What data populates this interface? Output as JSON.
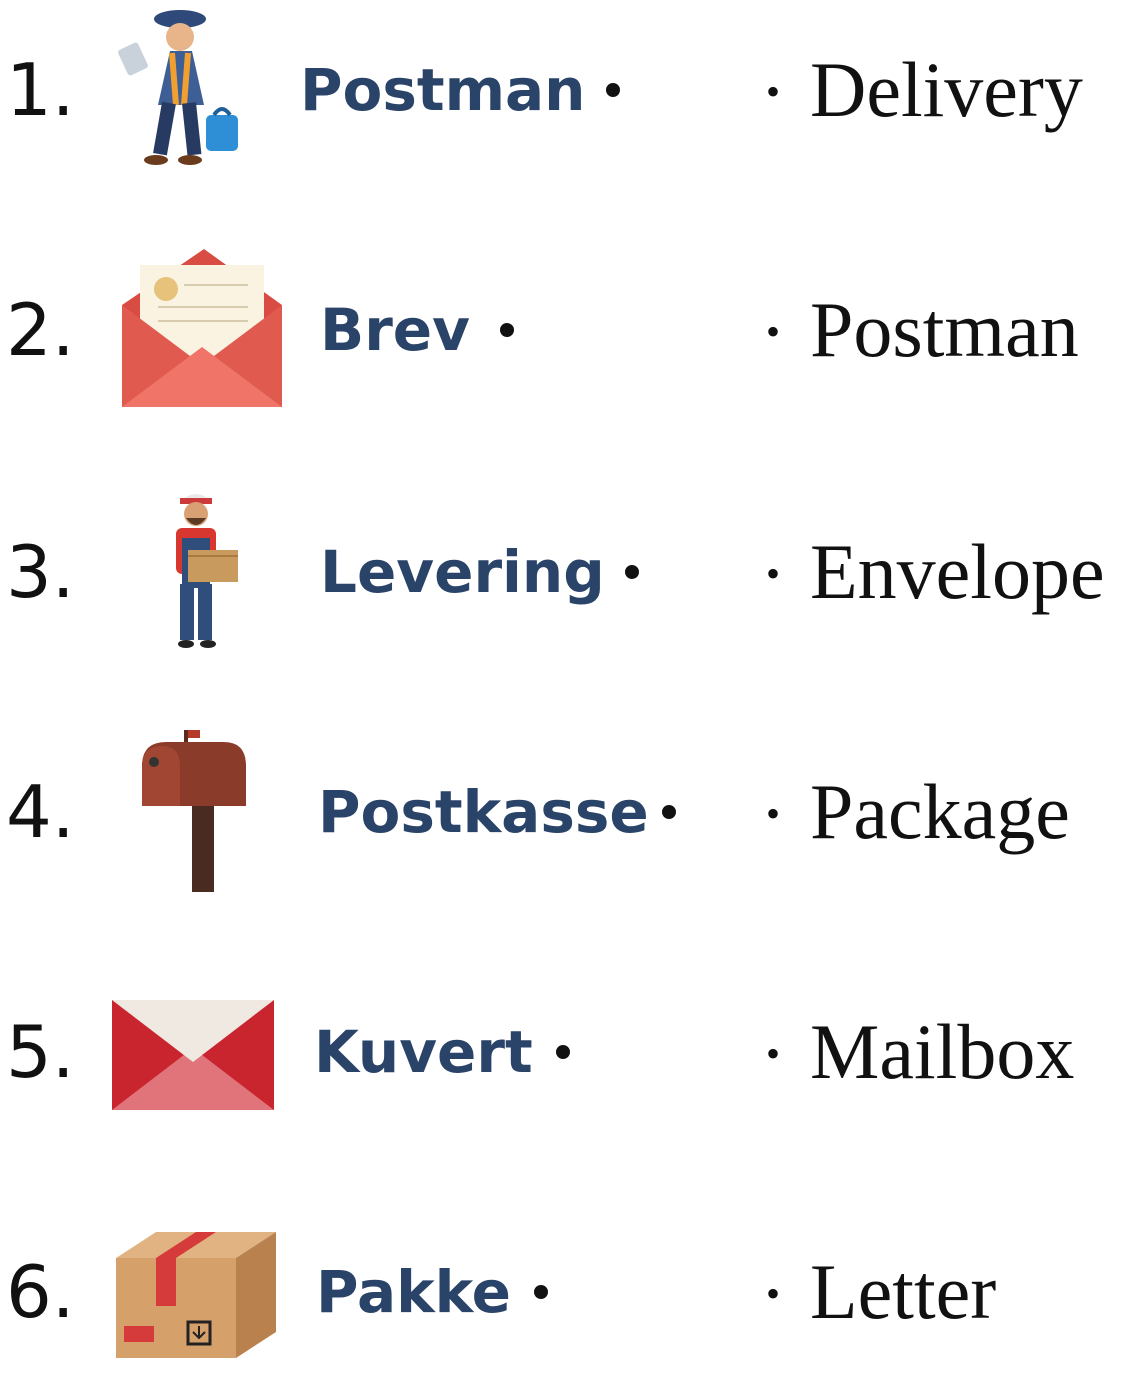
{
  "rows": [
    {
      "number": "1.",
      "word": "Postman",
      "match": "Delivery",
      "icon": "postman-icon"
    },
    {
      "number": "2.",
      "word": "Brev",
      "match": "Postman",
      "icon": "letter-icon"
    },
    {
      "number": "3.",
      "word": "Levering",
      "match": "Envelope",
      "icon": "delivery-worker-icon"
    },
    {
      "number": "4.",
      "word": "Postkasse",
      "match": "Package",
      "icon": "mailbox-icon"
    },
    {
      "number": "5.",
      "word": "Kuvert",
      "match": "Mailbox",
      "icon": "envelope-icon"
    },
    {
      "number": "6.",
      "word": "Pakke",
      "match": "Letter",
      "icon": "package-icon"
    }
  ],
  "colors": {
    "word": "#2a4368",
    "text": "#111111"
  }
}
